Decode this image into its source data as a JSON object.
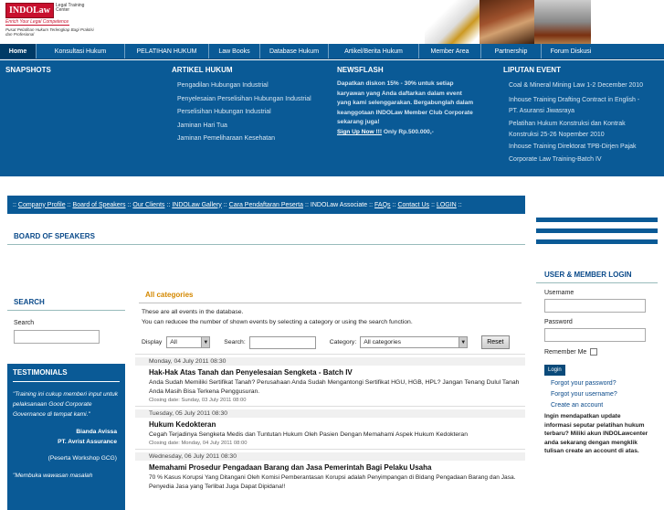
{
  "header": {
    "logo_main": "INDOLaw",
    "logo_side": "Legal Training Center",
    "logo_tagline": "Enrich Your Legal Competence",
    "logo_sub": "Pusat Pelatihan Hukum Terlengkap Bagi Praktisi dan Profesional"
  },
  "nav": {
    "items": [
      {
        "label": "Home",
        "active": true
      },
      {
        "label": "Konsultasi Hukum"
      },
      {
        "label": "PELATIHAN HUKUM"
      },
      {
        "label": "Law Books"
      },
      {
        "label": "Database Hukum"
      },
      {
        "label": "Artikel/Berita Hukum"
      },
      {
        "label": "Member Area"
      },
      {
        "label": "Partnership"
      },
      {
        "label": "Forum Diskusi"
      }
    ]
  },
  "mega": {
    "snapshots": {
      "title": "SNAPSHOTS"
    },
    "artikel": {
      "title": "ARTIKEL HUKUM",
      "links": [
        "Pengadilan Hubungan Industrial",
        "Penyelesaian Perselisihan Hubungan Industrial",
        "Perselisihan Hubungan Industrial",
        "Jaminan Hari Tua",
        "Jaminan Pemeliharaan Kesehatan"
      ]
    },
    "newsflash": {
      "title": "NEWSFLASH",
      "lines": [
        "Dapatkan diskon 15% - 30% untuk setiap",
        "karyawan yang Anda daftarkan dalam event",
        "yang kami selenggarakan. Bergabunglah dalam",
        "keanggotaan INDOLaw Member Club Corporate",
        "sekarang juga!"
      ],
      "signup": "Sign Up Now !!!",
      "price": " Only Rp.500.000,-"
    },
    "liputan": {
      "title": "LIPUTAN EVENT",
      "links": [
        "Coal & Mineral Mining Law 1-2 December 2010",
        "Inhouse Training Drafting Contract in English -",
        "PT. Asuransi Jiwasraya",
        "Pelatihan Hukum Konstruksi dan Kontrak",
        "Konstruksi 25-26 Nopember 2010",
        "Inhouse Training Direktorat TPB-Dirjen Pajak",
        "Corporate Law Training-Batch IV"
      ]
    }
  },
  "subnav": {
    "items": [
      "Company Profile",
      "Board of Speakers",
      "Our Clients",
      "INDOLaw Gallery",
      "Cara Pendaftaran Peserta",
      "INDOLaw Associate",
      "FAQs",
      "Contact Us",
      "LOGIN"
    ]
  },
  "page_title": "BOARD OF SPEAKERS",
  "left": {
    "search_title": "SEARCH",
    "search_label": "Search",
    "testi_title": "TESTIMONIALS",
    "testi_quote": "\"Training ini cukup memberi input untuk pelaksanaan Good Corporate Governance di tempat kami.\"",
    "testi_name": "Bianda Avissa",
    "testi_company": "PT. Avrist Assurance",
    "testi_program": "(Peserta Workshop GCG)",
    "testi_quote2": "\"Membuka wawasan masalah"
  },
  "main": {
    "cat_title": "All categories",
    "intro1": "These are all events in the database.",
    "intro2": "You can reducee the number of shown events by selecting a category or using the search function.",
    "display_label": "Display",
    "display_value": "All",
    "search_label": "Search:",
    "category_label": "Category:",
    "category_value": "All categories",
    "reset_label": "Reset",
    "events": [
      {
        "date": "Monday, 04 July 2011 08:30",
        "title": "Hak-Hak Atas Tanah dan Penyelesaian Sengketa - Batch IV",
        "desc": "Anda Sudah Memiliki Sertifikat Tanah? Perusahaan Anda Sudah Mengantongi Sertifikat HGU, HGB, HPL? Jangan Tenang Dulul Tanah Anda Masih Bisa Terkena Penggusuran.",
        "close": "Closing date: Sunday, 03 July 2011 08:00"
      },
      {
        "date": "Tuesday, 05 July 2011 08:30",
        "title": "Hukum Kedokteran",
        "desc": "Cegah Terjadinya Sengketa Medis dan Tuntutan Hukum Oleh Pasien Dengan Memahami Aspek Hukum Kedokteran",
        "close": "Closing date: Monday, 04 July 2011 08:00"
      },
      {
        "date": "Wednesday, 06 July 2011 08:30",
        "title": "Memahami Prosedur Pengadaan Barang dan Jasa Pemerintah Bagi Pelaku Usaha",
        "desc": "70 % Kasus Korupsi Yang Ditangani Oleh Komisi Pemberantasan Korupsi adalah Penyimpangan di Bidang Pengadaan Barang dan Jasa. Penyedia Jasa yang Terlibat Juga Dapat Dipidana!!",
        "close": ""
      }
    ]
  },
  "right": {
    "title": "USER & MEMBER LOGIN",
    "username_label": "Username",
    "password_label": "Password",
    "remember_label": "Remember Me",
    "login_label": "Login",
    "forgot_password": "Forgot your password?",
    "forgot_username": "Forgot your username?",
    "create_account": "Create an account",
    "info": "Ingin mendapatkan update informasi seputar pelatihan hukum terbaru? Miliki akun INDOLawcenter anda sekarang dengan mengklik tulisan create an account di atas."
  }
}
